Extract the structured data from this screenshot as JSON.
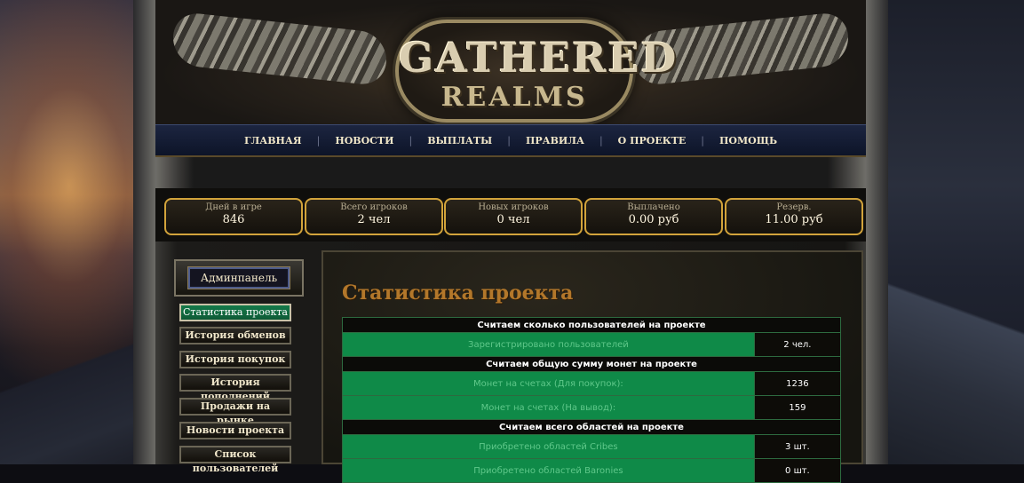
{
  "logo": {
    "line1": "GATHERED",
    "line2": "REALMS"
  },
  "nav": {
    "items": [
      "ГЛАВНАЯ",
      "НОВОСТИ",
      "ВЫПЛАТЫ",
      "ПРАВИЛА",
      "О ПРОЕКТЕ",
      "ПОМОЩЬ"
    ]
  },
  "stats": [
    {
      "label": "Дней в игре",
      "value": "846"
    },
    {
      "label": "Всего игроков",
      "value": "2 чел"
    },
    {
      "label": "Новых игроков",
      "value": "0 чел"
    },
    {
      "label": "Выплачено",
      "value": "0.00 руб"
    },
    {
      "label": "Резерв.",
      "value": "11.00 руб"
    }
  ],
  "sidebar": {
    "title": "Админпанель",
    "items": [
      "Статистика проекта",
      "История обменов",
      "История покупок",
      "История пополнений",
      "Продажи на рынке",
      "Новости проекта",
      "Список пользователей"
    ]
  },
  "main": {
    "title": "Статистика проекта",
    "table": {
      "section1": "Считаем сколько пользователей на проекте",
      "row1": {
        "k": "Зарегистрировано пользователей",
        "v": "2 чел."
      },
      "section2": "Считаем общую сумму монет на проекте",
      "row2": {
        "k": "Монет на счетах (Для покупок):",
        "v": "1236"
      },
      "row3": {
        "k": "Монет на счетах (На вывод):",
        "v": "159"
      },
      "section3": "Считаем всего областей на проекте",
      "row4": {
        "k": "Приобретено областей Cribes",
        "v": "3 шт."
      },
      "row5": {
        "k": "Приобретено областей Baronies",
        "v": "0 шт."
      }
    }
  }
}
